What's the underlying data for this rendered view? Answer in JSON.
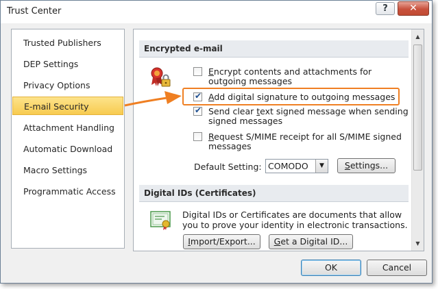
{
  "window": {
    "title": "Trust Center",
    "help_label": "?",
    "close_label": "✕"
  },
  "nav": {
    "items": [
      {
        "label": "Trusted Publishers",
        "selected": false
      },
      {
        "label": "DEP Settings",
        "selected": false
      },
      {
        "label": "Privacy Options",
        "selected": false
      },
      {
        "label": "E-mail Security",
        "selected": true
      },
      {
        "label": "Attachment Handling",
        "selected": false
      },
      {
        "label": "Automatic Download",
        "selected": false
      },
      {
        "label": "Macro Settings",
        "selected": false
      },
      {
        "label": "Programmatic Access",
        "selected": false
      }
    ]
  },
  "encrypted": {
    "header": "Encrypted e-mail",
    "icon": "certificate-lock-icon",
    "options": [
      {
        "label_line1": "Encrypt contents and attachments for",
        "label_line2": "outgoing messages",
        "checked": false
      },
      {
        "label_line1": "Add digital signature to outgoing messages",
        "label_line2": "",
        "checked": true
      },
      {
        "label_line1": "Send clear text signed message when sending",
        "label_line2": "signed messages",
        "checked": true
      },
      {
        "label_line1": "Request S/MIME receipt for all S/MIME signed",
        "label_line2": "messages",
        "checked": false
      }
    ],
    "default_setting_label": "Default Setting:",
    "default_setting_value": "COMODO",
    "settings_button": "Settings..."
  },
  "digital_ids": {
    "header": "Digital IDs (Certificates)",
    "icon": "certificate-document-icon",
    "description_line1": "Digital IDs or Certificates are documents that allow",
    "description_line2": "you to prove your identity in electronic transactions.",
    "import_export_button": "Import/Export...",
    "get_id_button": "Get a Digital ID..."
  },
  "footer": {
    "ok_label": "OK",
    "cancel_label": "Cancel"
  },
  "colors": {
    "accent_orange": "#ef7f22",
    "selected_nav": "#f7cb50",
    "close_red": "#c8513c"
  }
}
